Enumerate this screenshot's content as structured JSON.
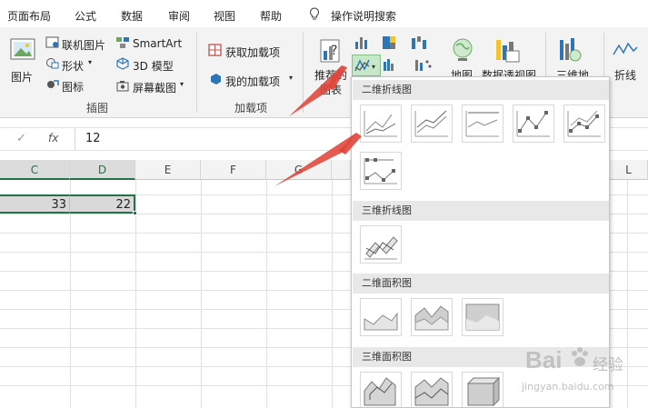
{
  "menu": [
    "页面布局",
    "公式",
    "数据",
    "审阅",
    "视图",
    "帮助",
    "操作说明搜索"
  ],
  "ribbon": {
    "picture": "图片",
    "online_picture": "联机图片",
    "shapes": "形状",
    "icons": "图标",
    "smartart": "SmartArt",
    "model3d": "3D 模型",
    "screenshot": "屏幕截图",
    "illustrations_group": "插图",
    "get_addins": "获取加载项",
    "my_addins": "我的加载项",
    "addins_group": "加载项",
    "recommended_charts_1": "推荐的",
    "recommended_charts_2": "图表",
    "maps": "地图",
    "pivot_chart": "数据透视图",
    "map3d": "三维地",
    "sparkline_line": "折线"
  },
  "formula": {
    "cancel": "✓",
    "fx": "fx",
    "value": "12"
  },
  "grid": {
    "columns": [
      "C",
      "D",
      "E",
      "F",
      "G",
      "L"
    ],
    "cells": {
      "C": "33",
      "D": "22"
    }
  },
  "dropdown": {
    "section_2d_line": "二维折线图",
    "section_3d_line": "三维折线图",
    "section_2d_area": "二维面积图",
    "section_3d_area": "三维面积图"
  },
  "watermark": {
    "brand": "Bai",
    "suffix": "经验",
    "url": "jingyan.baidu.com"
  },
  "colors": {
    "accent_green": "#217346",
    "arrow_red": "#e0443a",
    "highlight_green": "#c6e8c9"
  }
}
